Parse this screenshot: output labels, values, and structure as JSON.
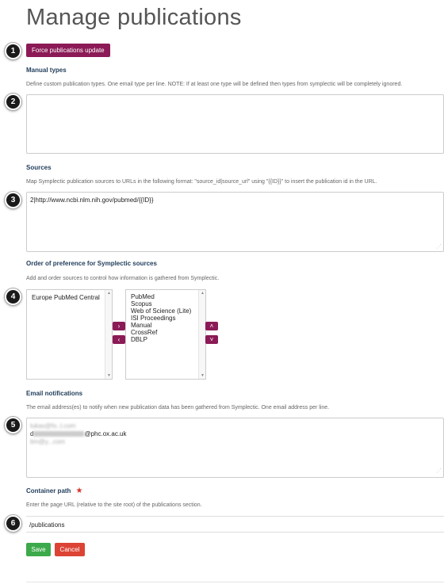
{
  "page": {
    "title": "Manage publications"
  },
  "steps": [
    "1",
    "2",
    "3",
    "4",
    "5",
    "6"
  ],
  "force_update_label": "Force publications update",
  "manual_types": {
    "label": "Manual types",
    "help": "Define custom publication types. One email type per line. NOTE: If at least one type will be defined then types from symplectic will be completely ignored.",
    "value": ""
  },
  "sources": {
    "label": "Sources",
    "help": "Map Symplectic publication sources to URLs in the following format: \"source_id|source_url\" using \"{{ID}}\" to insert the publication id in the URL.",
    "value": "2|http://www.ncbi.nlm.nih.gov/pubmed/{{ID}}"
  },
  "order": {
    "label": "Order of preference for Symplectic sources",
    "help": "Add and order sources to control how information is gathered from Symplectic.",
    "available": [
      "Europe PubMed Central"
    ],
    "selected": [
      "PubMed",
      "Scopus",
      "Web of Science (Lite)",
      "ISI Proceedings",
      "Manual",
      "CrossRef",
      "DBLP"
    ]
  },
  "email": {
    "label": "Email notifications",
    "help": "The email address(es) to notify when new publication data has been gathered from Symplectic. One email address per line.",
    "line1": "lukas@fo..t.com",
    "line2_blurred": "d",
    "line2_domain": "@phc.ox.ac.uk",
    "line3": "tim@y...com"
  },
  "container": {
    "label": "Container path",
    "required_mark": "★",
    "help": "Enter the page URL (relative to the site root) of the publications section.",
    "value": "/publications"
  },
  "actions": {
    "save": "Save",
    "cancel": "Cancel"
  },
  "icons": {
    "move_right": "›",
    "move_left": "‹",
    "move_up": "˄",
    "move_down": "˅",
    "scroll_up": "▲",
    "scroll_down": "▼",
    "resize_grip": "⋰"
  },
  "colors": {
    "accent": "#8b1a56",
    "save": "#3caa4a",
    "cancel": "#dc4335",
    "label": "#1f3c5a"
  }
}
